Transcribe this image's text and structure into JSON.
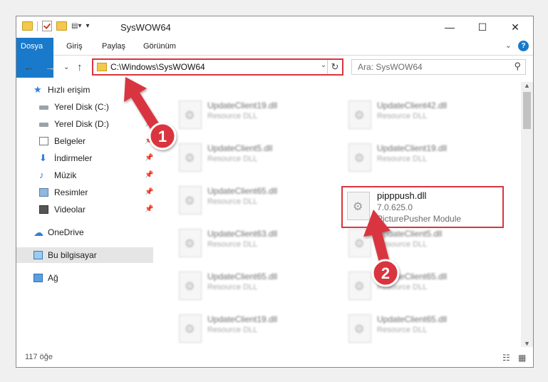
{
  "window": {
    "title": "SysWOW64",
    "controls": {
      "minimize": "—",
      "maximize": "☐",
      "close": "✕"
    }
  },
  "ribbon": {
    "tabs": [
      "Dosya",
      "Giriş",
      "Paylaş",
      "Görünüm"
    ],
    "help": "?"
  },
  "navigation": {
    "address_path": "C:\\Windows\\SysWOW64",
    "search_placeholder": "Ara: SysWOW64"
  },
  "sidebar": {
    "items": [
      {
        "label": "Hızlı erişim",
        "icon": "star-icon"
      },
      {
        "label": "Yerel Disk (C:)",
        "icon": "disk-icon"
      },
      {
        "label": "Yerel Disk (D:)",
        "icon": "disk-icon"
      },
      {
        "label": "Belgeler",
        "icon": "documents-icon"
      },
      {
        "label": "İndirmeler",
        "icon": "download-icon"
      },
      {
        "label": "Müzik",
        "icon": "music-icon"
      },
      {
        "label": "Resimler",
        "icon": "pictures-icon"
      },
      {
        "label": "Videolar",
        "icon": "videos-icon"
      },
      {
        "label": "OneDrive",
        "icon": "cloud-icon"
      },
      {
        "label": "Bu bilgisayar",
        "icon": "computer-icon"
      },
      {
        "label": "Ağ",
        "icon": "network-icon"
      }
    ],
    "selected": "Bu bilgisayar"
  },
  "files": {
    "items": [
      {
        "name": "UpdateClient19.dll",
        "type": "Resource DLL"
      },
      {
        "name": "UpdateClient42.dll",
        "type": "Resource DLL"
      },
      {
        "name": "UpdateClient5.dll",
        "type": "Resource DLL"
      },
      {
        "name": "UpdateClient19.dll",
        "type": "Resource DLL"
      },
      {
        "name": "UpdateClient65.dll",
        "type": "Resource DLL"
      },
      {
        "name": "UpdateClient63.dll",
        "type": "Resource DLL"
      },
      {
        "name": "UpdateClient5.dll",
        "type": "Resource DLL"
      },
      {
        "name": "UpdateClient65.dll",
        "type": "Resource DLL"
      },
      {
        "name": "UpdateClient65.dll",
        "type": "Resource DLL"
      },
      {
        "name": "UpdateClient19.dll",
        "type": "Resource DLL"
      },
      {
        "name": "UpdateClient65.dll",
        "type": "Resource DLL"
      }
    ],
    "highlighted": {
      "name": "pipppush.dll",
      "version": "7.0.625.0",
      "description": "PicturePusher Module"
    }
  },
  "status": {
    "item_count": "117 öğe"
  },
  "annotations": {
    "step1": "1",
    "step2": "2",
    "accent_color": "#d9343f"
  }
}
